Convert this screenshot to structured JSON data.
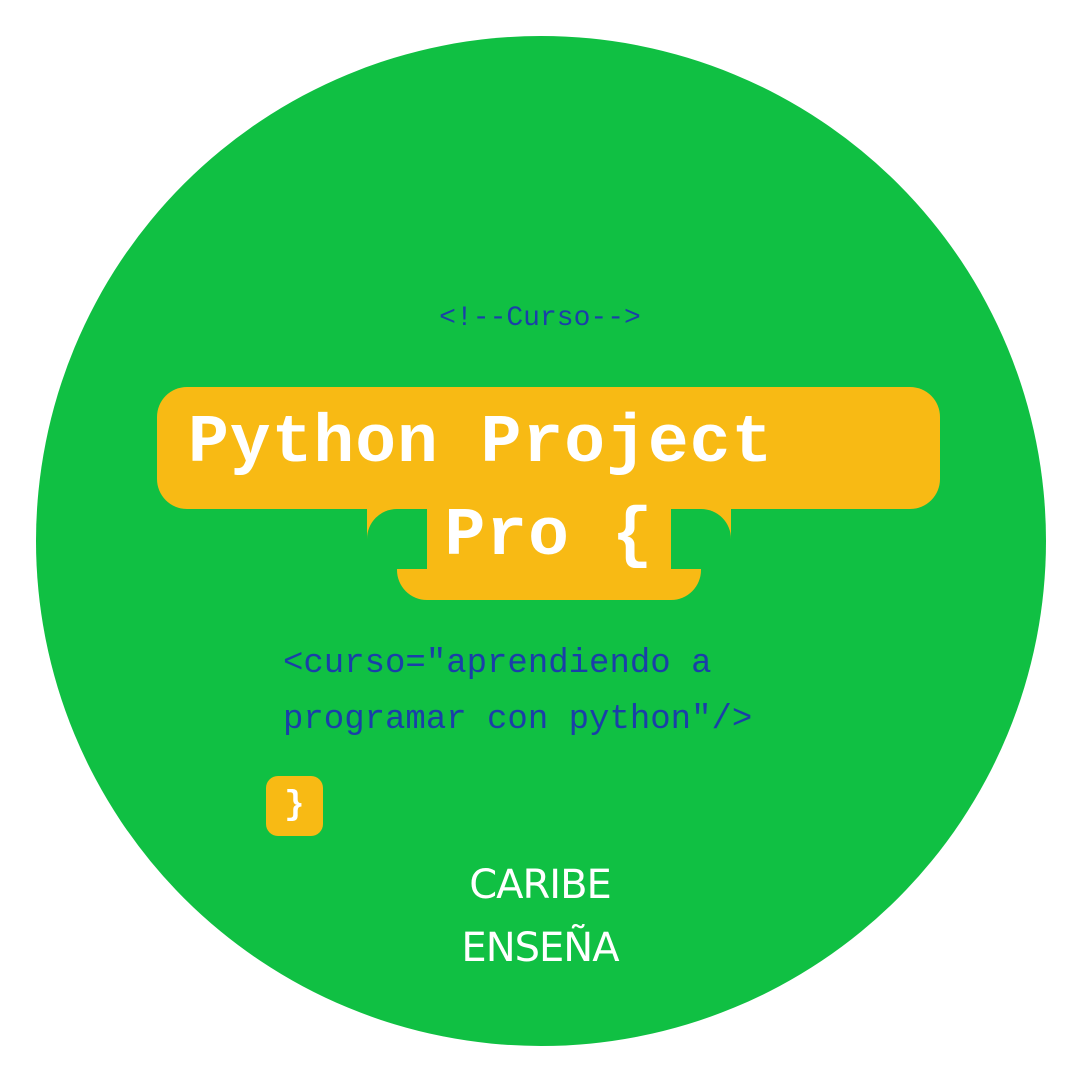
{
  "logo": {
    "comment": "<!--Curso-->",
    "title_line1": "Python Project",
    "title_line2": "Pro {",
    "code_line1": "<curso=\"aprendiendo a",
    "code_line2": "programar con python\"/>",
    "closing_brace": "}",
    "brand_line1": "CARIBE",
    "brand_line2": "ENSEÑA"
  },
  "colors": {
    "background": "#ffffff",
    "circle": "#10c043",
    "accent": "#f8ba14",
    "code_text": "#1a3fa8",
    "title_text": "#ffffff"
  }
}
